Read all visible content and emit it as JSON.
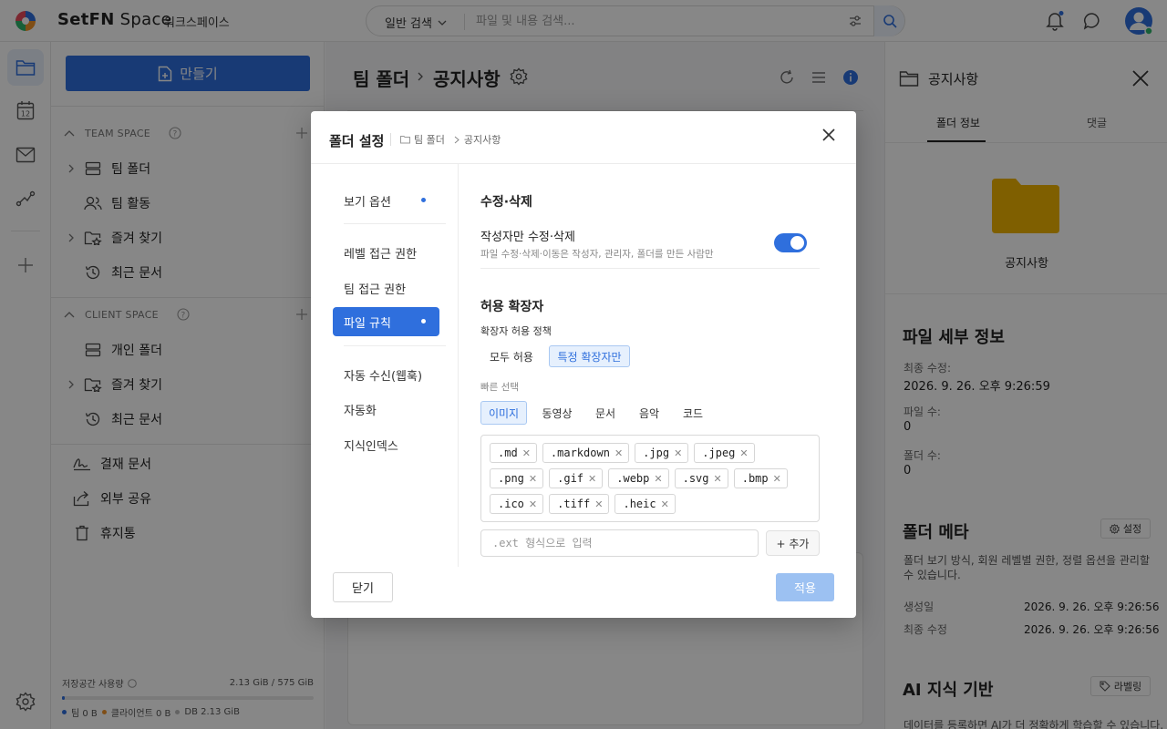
{
  "app": {
    "logo_text_bold": "SetFN",
    "logo_text_light": " Space",
    "workspace": "워크스페이스"
  },
  "search": {
    "mode": "일반 검색",
    "placeholder": "파일 및 내용 검색..."
  },
  "sidebar": {
    "create_label": "만들기",
    "team_space": {
      "header": "TEAM SPACE",
      "items": [
        {
          "label": "팀 폴더",
          "icon": "server-icon"
        },
        {
          "label": "팀 활동",
          "icon": "users-icon"
        },
        {
          "label": "즐겨 찾기",
          "icon": "star-folder-icon"
        },
        {
          "label": "최근 문서",
          "icon": "history-icon"
        }
      ]
    },
    "client_space": {
      "header": "CLIENT SPACE",
      "items": [
        {
          "label": "개인 폴더",
          "icon": "server-icon"
        },
        {
          "label": "즐겨 찾기",
          "icon": "star-folder-icon"
        },
        {
          "label": "최근 문서",
          "icon": "history-icon"
        }
      ]
    },
    "other_items": [
      {
        "label": "결재 문서",
        "icon": "signature-icon"
      },
      {
        "label": "외부 공유",
        "icon": "share-icon"
      },
      {
        "label": "휴지통",
        "icon": "trash-icon"
      }
    ],
    "storage": {
      "label": "저장공간 사용량",
      "value": "2.13 GiB / 575 GiB",
      "fill_fraction": 0.004,
      "legend": [
        {
          "label": "팀 0 B",
          "color": "#2f6fdd"
        },
        {
          "label": "클라이언트 0 B",
          "color": "#f0932b"
        },
        {
          "label": "DB 2.13 GiB",
          "color": "#bbbbbb"
        }
      ]
    }
  },
  "main": {
    "breadcrumb_root": "팀 폴더",
    "breadcrumb_current": "공지사항"
  },
  "right_panel": {
    "title": "공지사항",
    "tabs": [
      "폴더 정보",
      "댓글"
    ],
    "folder_name": "공지사항",
    "details_title": "파일 세부 정보",
    "details": [
      {
        "label": "최종 수정:",
        "value": "2026. 9. 26. 오후 9:26:59"
      },
      {
        "label": "파일 수:",
        "value": "0"
      },
      {
        "label": "폴더 수:",
        "value": "0"
      }
    ],
    "meta_title": "폴더 메타",
    "meta_settings": "설정",
    "meta_desc": "폴더 보기 방식, 회원 레벨별 권한, 정렬 옵션을 관리할 수 있습니다.",
    "meta_rows": [
      {
        "label": "생성일",
        "value": "2026. 9. 26. 오후 9:26:56"
      },
      {
        "label": "최종 수정",
        "value": "2026. 9. 26. 오후 9:26:56"
      }
    ],
    "ai_title": "AI 지식 기반",
    "ai_button": "라벨링",
    "ai_desc": "데이터를 등록하면 AI가 더 정확하게 학습할 수 있습니다. 지"
  },
  "modal": {
    "title": "폴더 설정",
    "crumb": [
      "팀 폴더",
      "공지사항"
    ],
    "tabs": [
      {
        "label": "보기 옵션",
        "dot": true
      },
      {
        "label": "레벨 접근 권한",
        "dot": false
      },
      {
        "label": "팀 접근 권한",
        "dot": false
      },
      {
        "label": "파일 규칙",
        "dot": true,
        "active": true
      },
      {
        "label": "자동 수신(웹훅)",
        "dot": false
      },
      {
        "label": "자동화",
        "dot": false
      },
      {
        "label": "지식인덱스",
        "dot": false
      }
    ],
    "edit_section": "수정·삭제",
    "edit_toggle_label": "작성자만 수정·삭제",
    "edit_toggle_desc": "파일 수정·삭제·이동은 작성자, 관리자, 폴더를 만든 사람만",
    "edit_toggle_on": true,
    "ext_section": "허용 확장자",
    "policy_label": "확장자 허용 정책",
    "policy_options": [
      "모두 허용",
      "특정 확장자만"
    ],
    "policy_selected": "특정 확장자만",
    "quick_label": "빠른 선택",
    "quick_options": [
      "이미지",
      "동영상",
      "문서",
      "음악",
      "코드"
    ],
    "quick_selected": "이미지",
    "extensions": [
      ".md",
      ".markdown",
      ".jpg",
      ".jpeg",
      ".png",
      ".gif",
      ".webp",
      ".svg",
      ".bmp",
      ".ico",
      ".tiff",
      ".heic"
    ],
    "ext_placeholder": ".ext 형식으로 입력",
    "add_label": "+ 추가",
    "close_label": "닫기",
    "apply_label": "적용"
  },
  "colors": {
    "accent": "#2f6fdd",
    "folder": "#f0b400"
  }
}
